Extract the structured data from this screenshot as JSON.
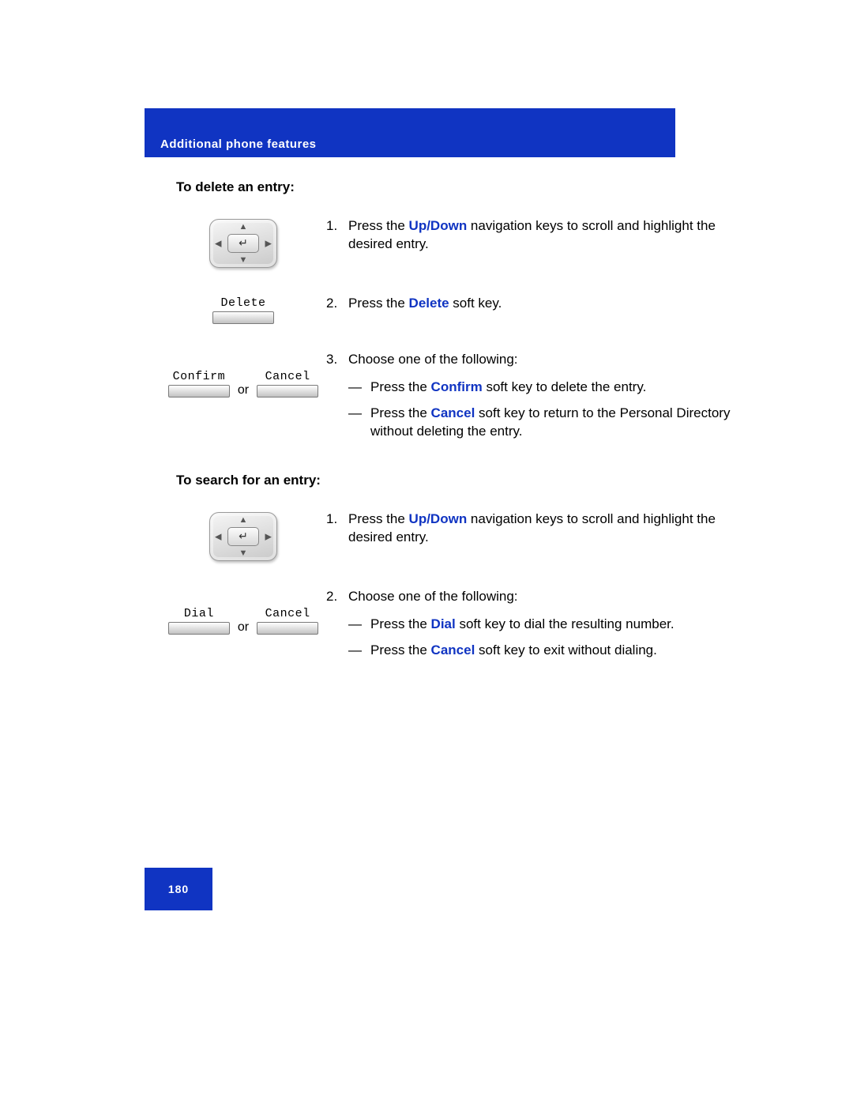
{
  "header": {
    "title": "Additional phone features"
  },
  "page_number": "180",
  "or_label": "or",
  "sections": {
    "delete": {
      "title": "To delete an entry:",
      "steps": [
        {
          "num": "1.",
          "pre": "Press the ",
          "accent": "Up/Down",
          "post": " navigation keys to scroll and highlight the desired entry."
        },
        {
          "num": "2.",
          "pre": "Press the ",
          "accent": "Delete",
          "post": " soft key.",
          "softkey": "Delete"
        },
        {
          "num": "3.",
          "pre": "Choose one of the following:",
          "softkeys": [
            "Confirm",
            "Cancel"
          ],
          "subs": [
            {
              "pre": "Press the ",
              "accent": "Confirm",
              "post": " soft key to delete the entry."
            },
            {
              "pre": "Press the ",
              "accent": "Cancel",
              "post": " soft key to return to the Personal Directory without deleting the entry."
            }
          ]
        }
      ]
    },
    "search": {
      "title": "To search for an entry:",
      "steps": [
        {
          "num": "1.",
          "pre": "Press the ",
          "accent": "Up/Down",
          "post": " navigation keys to scroll and highlight the desired entry."
        },
        {
          "num": "2.",
          "pre": "Choose one of the following:",
          "softkeys": [
            "Dial",
            "Cancel"
          ],
          "subs": [
            {
              "pre": "Press the ",
              "accent": "Dial",
              "post": " soft key to dial the resulting number."
            },
            {
              "pre": "Press the ",
              "accent": "Cancel",
              "post": " soft key to exit without dialing."
            }
          ]
        }
      ]
    }
  }
}
